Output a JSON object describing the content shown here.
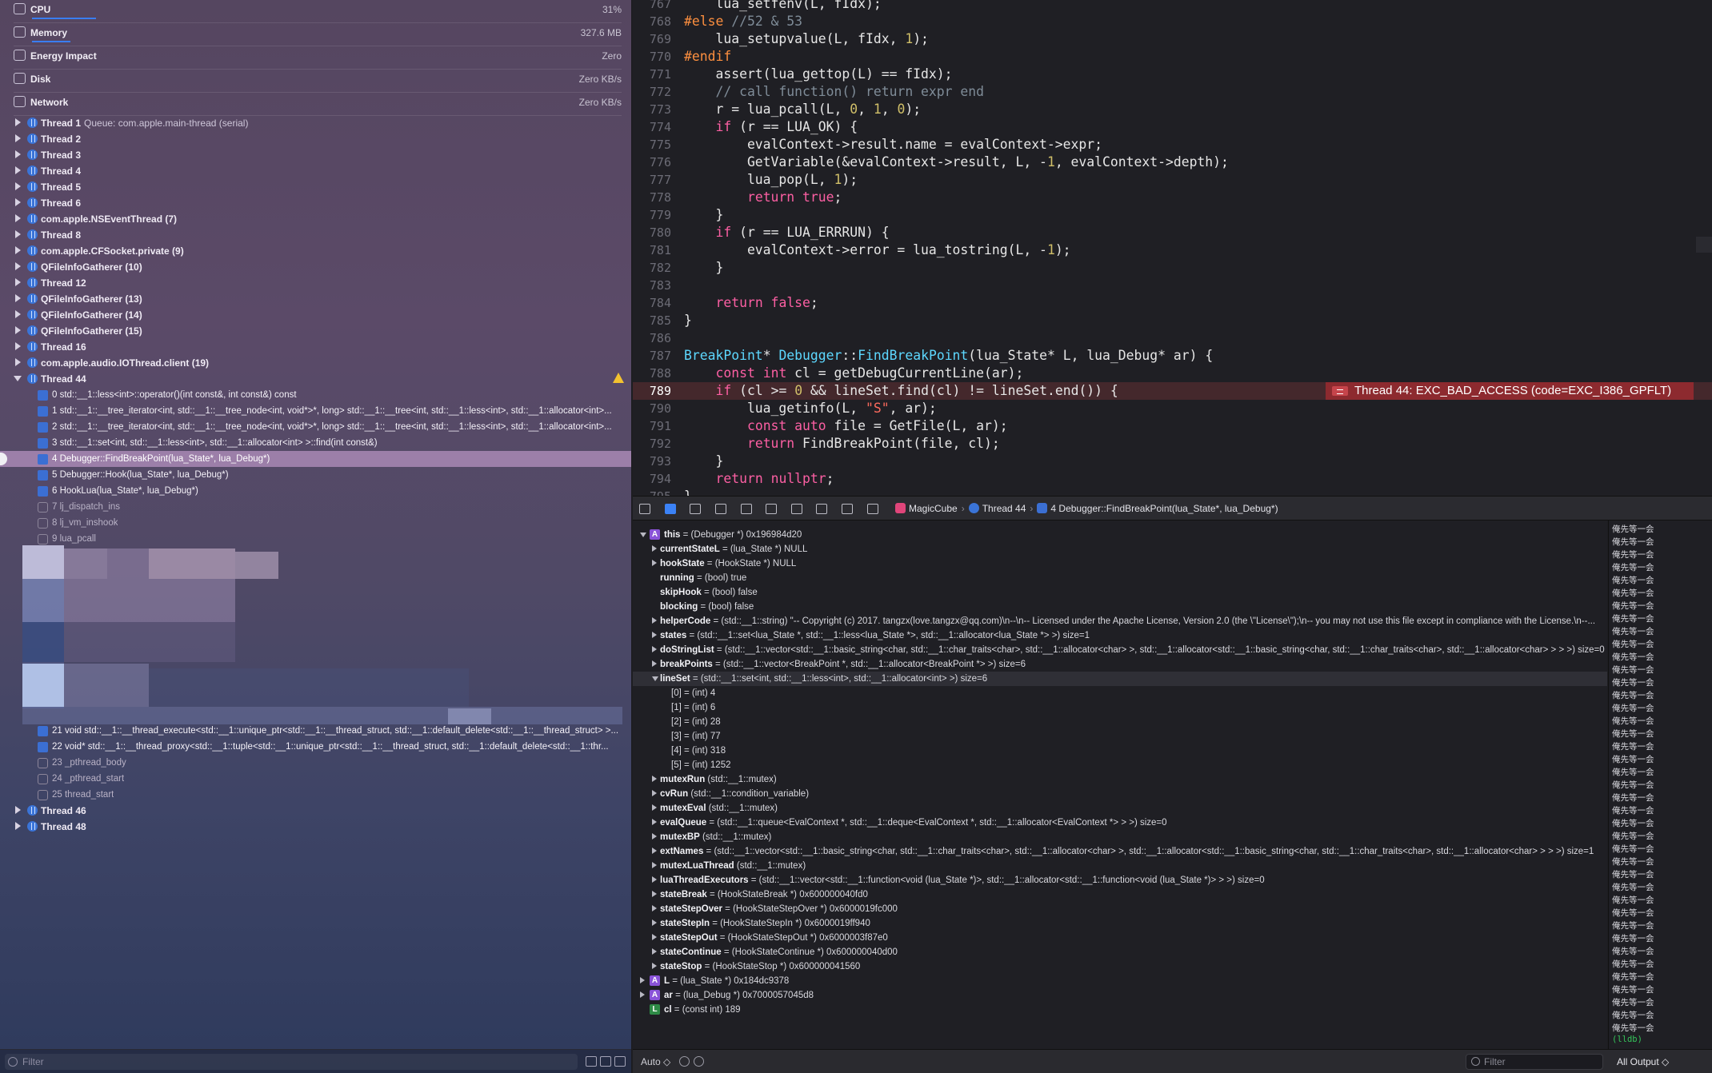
{
  "gauges": [
    {
      "label": "CPU",
      "value": "31%"
    },
    {
      "label": "Memory",
      "value": "327.6 MB"
    },
    {
      "label": "Energy Impact",
      "value": "Zero"
    },
    {
      "label": "Disk",
      "value": "Zero KB/s"
    },
    {
      "label": "Network",
      "value": "Zero KB/s"
    }
  ],
  "threads": [
    {
      "label": "Thread 1",
      "sub": "Queue: com.apple.main-thread (serial)"
    },
    {
      "label": "Thread 2"
    },
    {
      "label": "Thread 3"
    },
    {
      "label": "Thread 4"
    },
    {
      "label": "Thread 5"
    },
    {
      "label": "Thread 6"
    },
    {
      "label": "com.apple.NSEventThread (7)"
    },
    {
      "label": "Thread 8"
    },
    {
      "label": "com.apple.CFSocket.private (9)"
    },
    {
      "label": "QFileInfoGatherer (10)"
    },
    {
      "label": "Thread 12"
    },
    {
      "label": "QFileInfoGatherer (13)"
    },
    {
      "label": "QFileInfoGatherer (14)"
    },
    {
      "label": "QFileInfoGatherer (15)"
    },
    {
      "label": "Thread 16"
    },
    {
      "label": "com.apple.audio.IOThread.client (19)"
    },
    {
      "label": "Thread 44"
    }
  ],
  "frames_top": [
    "0 std::__1::less<int>::operator()(int const&, int const&) const",
    "1 std::__1::__tree_iterator<int, std::__1::__tree_node<int, void*>*, long> std::__1::__tree<int, std::__1::less<int>, std::__1::allocator<int>...",
    "2 std::__1::__tree_iterator<int, std::__1::__tree_node<int, void*>*, long> std::__1::__tree<int, std::__1::less<int>, std::__1::allocator<int>...",
    "3 std::__1::set<int, std::__1::less<int>, std::__1::allocator<int> >::find(int const&)",
    "4 Debugger::FindBreakPoint(lua_State*, lua_Debug*)",
    "5 Debugger::Hook(lua_State*, lua_Debug*)",
    "6 HookLua(lua_State*, lua_Debug*)",
    "7 lj_dispatch_ins",
    "8 lj_vm_inshook",
    "9 lua_pcall"
  ],
  "frames_bottom": [
    "21 void std::__1::__thread_execute<std::__1::unique_ptr<std::__1::__thread_struct, std::__1::default_delete<std::__1::__thread_struct> >...",
    "22 void* std::__1::__thread_proxy<std::__1::tuple<std::__1::unique_ptr<std::__1::__thread_struct, std::__1::default_delete<std::__1::thr...",
    "23 _pthread_body",
    "24 _pthread_start",
    "25 thread_start"
  ],
  "threads_after": [
    {
      "label": "Thread 46"
    },
    {
      "label": "Thread 48"
    }
  ],
  "nav_filter_placeholder": "Filter",
  "code_lines": [
    {
      "n": "767",
      "html": "    lua_setfenv(L, fIdx);"
    },
    {
      "n": "768",
      "html": "<span class='pp'>#else</span> <span class='c'>//52 &amp; 53</span>"
    },
    {
      "n": "769",
      "html": "    lua_setupvalue(L, fIdx, <span class='n'>1</span>);"
    },
    {
      "n": "770",
      "html": "<span class='pp'>#endif</span>"
    },
    {
      "n": "771",
      "html": "    assert(lua_gettop(L) == fIdx);"
    },
    {
      "n": "772",
      "html": "    <span class='c'>// call function() return expr end</span>"
    },
    {
      "n": "773",
      "html": "    r = lua_pcall(L, <span class='n'>0</span>, <span class='n'>1</span>, <span class='n'>0</span>);"
    },
    {
      "n": "774",
      "html": "    <span class='k'>if</span> (r == LUA_OK) {"
    },
    {
      "n": "775",
      "html": "        evalContext->result.name = evalContext->expr;"
    },
    {
      "n": "776",
      "html": "        GetVariable(&amp;evalContext->result, L, -<span class='n'>1</span>, evalContext->depth);"
    },
    {
      "n": "777",
      "html": "        lua_pop(L, <span class='n'>1</span>);"
    },
    {
      "n": "778",
      "html": "        <span class='k'>return</span> <span class='k'>true</span>;"
    },
    {
      "n": "779",
      "html": "    }"
    },
    {
      "n": "780",
      "html": "    <span class='k'>if</span> (r == LUA_ERRRUN) {"
    },
    {
      "n": "781",
      "html": "        evalContext->error = lua_tostring(L, -<span class='n'>1</span>);"
    },
    {
      "n": "782",
      "html": "    }"
    },
    {
      "n": "783",
      "html": ""
    },
    {
      "n": "784",
      "html": "    <span class='k'>return</span> <span class='k'>false</span>;"
    },
    {
      "n": "785",
      "html": "}"
    },
    {
      "n": "786",
      "html": ""
    },
    {
      "n": "787",
      "html": "<span class='t'>BreakPoint</span>* <span class='t'>Debugger</span>::<span class='t'>FindBreakPoint</span>(lua_State* L, lua_Debug* ar) {"
    },
    {
      "n": "788",
      "html": "    <span class='k'>const</span> <span class='k'>int</span> cl = getDebugCurrentLine(ar);"
    },
    {
      "n": "789",
      "html": "    <span class='k'>if</span> (cl >= <span class='n'>0</span> &amp;&amp; lineSet.find(cl) != lineSet.end()) {",
      "error": true
    },
    {
      "n": "790",
      "html": "        lua_getinfo(L, <span class='s'>\"S\"</span>, ar);"
    },
    {
      "n": "791",
      "html": "        <span class='k'>const</span> <span class='k'>auto</span> file = GetFile(L, ar);"
    },
    {
      "n": "792",
      "html": "        <span class='k'>return</span> FindBreakPoint(file, cl);"
    },
    {
      "n": "793",
      "html": "    }"
    },
    {
      "n": "794",
      "html": "    <span class='k'>return</span> <span class='k'>nullptr</span>;"
    },
    {
      "n": "795",
      "html": "}"
    }
  ],
  "error_message": "Thread 44: EXC_BAD_ACCESS (code=EXC_I386_GPFLT)",
  "breadcrumb": {
    "app": "MagicCube",
    "thread": "Thread 44",
    "frame": "4 Debugger::FindBreakPoint(lua_State*, lua_Debug*)"
  },
  "variables": [
    {
      "d": 0,
      "disc": "open",
      "badge": "A",
      "name": "this",
      "val": " = (Debugger *) 0x196984d20"
    },
    {
      "d": 1,
      "disc": "closed",
      "name": "currentStateL",
      "val": " = (lua_State *) NULL"
    },
    {
      "d": 1,
      "disc": "closed",
      "name": "hookState",
      "val": " = (HookState *) NULL"
    },
    {
      "d": 1,
      "disc": "none",
      "name": "running",
      "val": " = (bool) true"
    },
    {
      "d": 1,
      "disc": "none",
      "name": "skipHook",
      "val": " = (bool) false"
    },
    {
      "d": 1,
      "disc": "none",
      "name": "blocking",
      "val": " = (bool) false"
    },
    {
      "d": 1,
      "disc": "closed",
      "name": "helperCode",
      "val": " = (std::__1::string) \"-- Copyright (c) 2017. tangzx(love.tangzx@qq.com)\\n--\\n-- Licensed under the Apache License, Version 2.0 (the \\\"License\\\");\\n-- you may not use this file except in compliance with the License.\\n--..."
    },
    {
      "d": 1,
      "disc": "closed",
      "name": "states",
      "val": " = (std::__1::set<lua_State *, std::__1::less<lua_State *>, std::__1::allocator<lua_State *> >) size=1"
    },
    {
      "d": 1,
      "disc": "closed",
      "name": "doStringList",
      "val": " = (std::__1::vector<std::__1::basic_string<char, std::__1::char_traits<char>, std::__1::allocator<char> >, std::__1::allocator<std::__1::basic_string<char, std::__1::char_traits<char>, std::__1::allocator<char> > > >) size=0"
    },
    {
      "d": 1,
      "disc": "closed",
      "name": "breakPoints",
      "val": " = (std::__1::vector<BreakPoint *, std::__1::allocator<BreakPoint *> >) size=6"
    },
    {
      "d": 1,
      "disc": "open",
      "name": "lineSet",
      "val": " = (std::__1::set<int, std::__1::less<int>, std::__1::allocator<int> >) size=6",
      "hl": true
    },
    {
      "d": 2,
      "disc": "none",
      "name": "[0]",
      "val": " = (int) 4",
      "plain": true
    },
    {
      "d": 2,
      "disc": "none",
      "name": "[1]",
      "val": " = (int) 6",
      "plain": true
    },
    {
      "d": 2,
      "disc": "none",
      "name": "[2]",
      "val": " = (int) 28",
      "plain": true
    },
    {
      "d": 2,
      "disc": "none",
      "name": "[3]",
      "val": " = (int) 77",
      "plain": true
    },
    {
      "d": 2,
      "disc": "none",
      "name": "[4]",
      "val": " = (int) 318",
      "plain": true
    },
    {
      "d": 2,
      "disc": "none",
      "name": "[5]",
      "val": " = (int) 1252",
      "plain": true
    },
    {
      "d": 1,
      "disc": "closed",
      "name": "mutexRun",
      "val": " (std::__1::mutex)"
    },
    {
      "d": 1,
      "disc": "closed",
      "name": "cvRun",
      "val": " (std::__1::condition_variable)"
    },
    {
      "d": 1,
      "disc": "closed",
      "name": "mutexEval",
      "val": " (std::__1::mutex)"
    },
    {
      "d": 1,
      "disc": "closed",
      "name": "evalQueue",
      "val": " = (std::__1::queue<EvalContext *, std::__1::deque<EvalContext *, std::__1::allocator<EvalContext *> > >) size=0"
    },
    {
      "d": 1,
      "disc": "closed",
      "name": "mutexBP",
      "val": " (std::__1::mutex)"
    },
    {
      "d": 1,
      "disc": "closed",
      "name": "extNames",
      "val": " = (std::__1::vector<std::__1::basic_string<char, std::__1::char_traits<char>, std::__1::allocator<char> >, std::__1::allocator<std::__1::basic_string<char, std::__1::char_traits<char>, std::__1::allocator<char> > > >) size=1"
    },
    {
      "d": 1,
      "disc": "closed",
      "name": "mutexLuaThread",
      "val": " (std::__1::mutex)"
    },
    {
      "d": 1,
      "disc": "closed",
      "name": "luaThreadExecutors",
      "val": " = (std::__1::vector<std::__1::function<void (lua_State *)>, std::__1::allocator<std::__1::function<void (lua_State *)> > >) size=0"
    },
    {
      "d": 1,
      "disc": "closed",
      "name": "stateBreak",
      "val": " = (HookStateBreak *) 0x600000040fd0"
    },
    {
      "d": 1,
      "disc": "closed",
      "name": "stateStepOver",
      "val": " = (HookStateStepOver *) 0x6000019fc000"
    },
    {
      "d": 1,
      "disc": "closed",
      "name": "stateStepIn",
      "val": " = (HookStateStepIn *) 0x6000019ff940"
    },
    {
      "d": 1,
      "disc": "closed",
      "name": "stateStepOut",
      "val": " = (HookStateStepOut *) 0x6000003f87e0"
    },
    {
      "d": 1,
      "disc": "closed",
      "name": "stateContinue",
      "val": " = (HookStateContinue *) 0x600000040d00"
    },
    {
      "d": 1,
      "disc": "closed",
      "name": "stateStop",
      "val": " = (HookStateStop *) 0x600000041560"
    },
    {
      "d": 0,
      "disc": "closed",
      "badge": "A",
      "name": "L",
      "val": " = (lua_State *) 0x184dc9378"
    },
    {
      "d": 0,
      "disc": "closed",
      "badge": "A",
      "name": "ar",
      "val": " = (lua_Debug *) 0x7000057045d8"
    },
    {
      "d": 0,
      "disc": "none",
      "badge": "L",
      "name": "cl",
      "val": " = (const int) 189"
    }
  ],
  "console_line": "俺先等一会",
  "console_prompt": "(lldb)",
  "bottom": {
    "auto": "Auto ◇",
    "filter": "Filter",
    "output": "All Output ◇"
  }
}
